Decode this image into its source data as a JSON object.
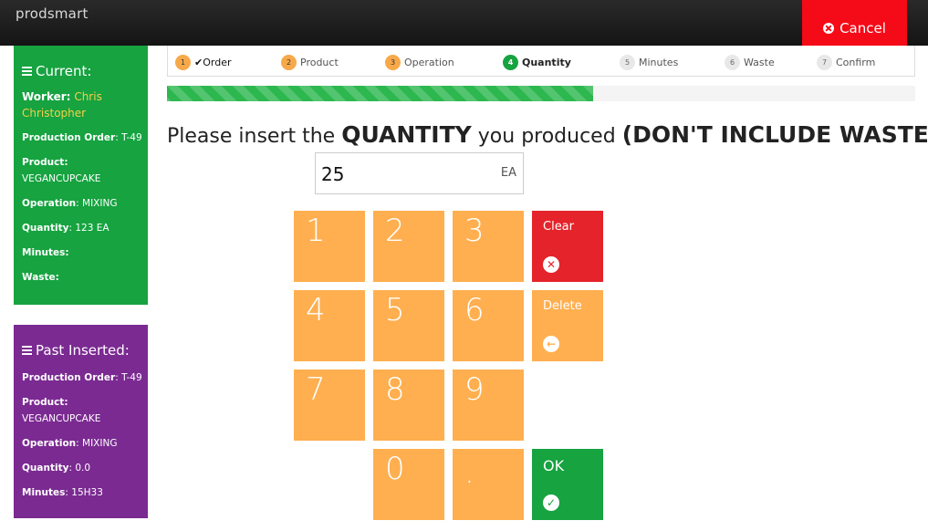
{
  "app": {
    "logo": "prodsmart"
  },
  "header": {
    "cancel_label": "Cancel"
  },
  "current": {
    "title": "Current:",
    "worker_label": "Worker:",
    "worker_value": "Chris Christopher",
    "rows": [
      {
        "label": "Production Order",
        "value": ": T-49"
      },
      {
        "label": "Product:",
        "value": "VEGANCUPCAKE"
      },
      {
        "label": "Operation",
        "value": ": MIXING"
      },
      {
        "label": "Quantity",
        "value": ": 123 EA"
      },
      {
        "label": "Minutes:",
        "value": ""
      },
      {
        "label": "Waste:",
        "value": ""
      }
    ]
  },
  "past": {
    "title": "Past Inserted:",
    "rows": [
      {
        "label": "Production Order",
        "value": ": T-49"
      },
      {
        "label": "Product:",
        "value": "VEGANCUPCAKE"
      },
      {
        "label": "Operation",
        "value": ": MIXING"
      },
      {
        "label": "Quantity",
        "value": ": 0.0"
      },
      {
        "label": "Minutes",
        "value": ": 15H33"
      }
    ]
  },
  "steps": [
    {
      "num": "1",
      "label": "Order",
      "state": "done",
      "check": "✔"
    },
    {
      "num": "2",
      "label": "Product",
      "state": "ok"
    },
    {
      "num": "3",
      "label": "Operation",
      "state": "ok"
    },
    {
      "num": "4",
      "label": "Quantity",
      "state": "active"
    },
    {
      "num": "5",
      "label": "Minutes",
      "state": "todo"
    },
    {
      "num": "6",
      "label": "Waste",
      "state": "todo"
    },
    {
      "num": "7",
      "label": "Confirm",
      "state": "todo"
    }
  ],
  "progress": {
    "fraction": 0.57
  },
  "prompt": {
    "part1": "Please insert the ",
    "part2": "QUANTITY",
    "part3": " you produced ",
    "part4": "(DON'T INCLUDE WASTE)",
    "part5": ":"
  },
  "quantity_input": {
    "value": "25",
    "unit": "EA"
  },
  "keypad": {
    "digits": [
      "1",
      "2",
      "3",
      "4",
      "5",
      "6",
      "7",
      "8",
      "9",
      "0",
      "."
    ],
    "clear_label": "Clear",
    "delete_label": "Delete",
    "ok_label": "OK"
  },
  "colors": {
    "green": "#16a340",
    "purple": "#7b2a92",
    "orange": "#ffaf4f",
    "red": "#e5232a",
    "cancel_red": "#f50a18"
  }
}
